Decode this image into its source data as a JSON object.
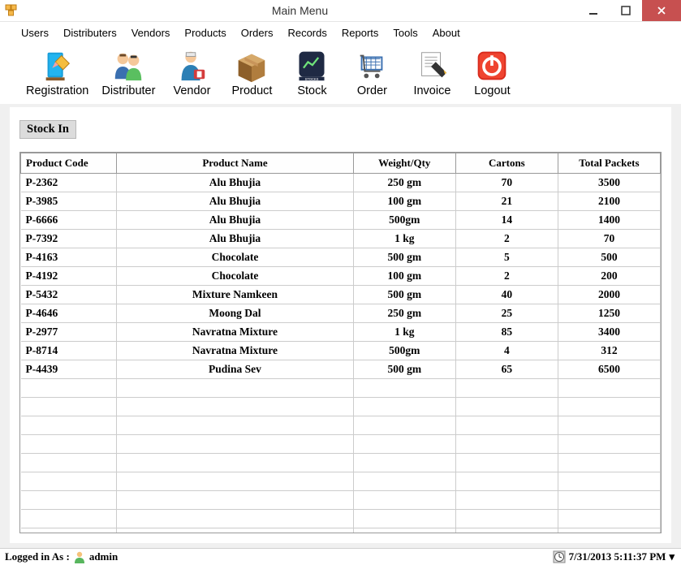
{
  "window": {
    "title": "Main Menu"
  },
  "menus": [
    "Users",
    "Distributers",
    "Vendors",
    "Products",
    "Orders",
    "Records",
    "Reports",
    "Tools",
    "About"
  ],
  "toolbar": [
    {
      "label": "Registration"
    },
    {
      "label": "Distributer"
    },
    {
      "label": "Vendor"
    },
    {
      "label": "Product"
    },
    {
      "label": "Stock"
    },
    {
      "label": "Order"
    },
    {
      "label": "Invoice"
    },
    {
      "label": "Logout"
    }
  ],
  "section": {
    "title": "Stock In"
  },
  "table": {
    "headers": [
      "Product Code",
      "Product Name",
      "Weight/Qty",
      "Cartons",
      "Total Packets"
    ],
    "rows": [
      [
        "P-2362",
        "Alu Bhujia",
        "250 gm",
        "70",
        "3500"
      ],
      [
        "P-3985",
        "Alu Bhujia",
        "100 gm",
        "21",
        "2100"
      ],
      [
        "P-6666",
        "Alu Bhujia",
        "500gm",
        "14",
        "1400"
      ],
      [
        "P-7392",
        "Alu Bhujia",
        "1 kg",
        "2",
        "70"
      ],
      [
        "P-4163",
        "Chocolate",
        "500 gm",
        "5",
        "500"
      ],
      [
        "P-4192",
        "Chocolate",
        "100 gm",
        "2",
        "200"
      ],
      [
        "P-5432",
        "Mixture Namkeen",
        "500 gm",
        "40",
        "2000"
      ],
      [
        "P-4646",
        "Moong Dal",
        "250 gm",
        "25",
        "1250"
      ],
      [
        "P-2977",
        "Navratna Mixture",
        "1 kg",
        "85",
        "3400"
      ],
      [
        "P-8714",
        "Navratna Mixture",
        "500gm",
        "4",
        "312"
      ],
      [
        "P-4439",
        "Pudina Sev",
        "500 gm",
        "65",
        "6500"
      ]
    ]
  },
  "status": {
    "login_label": "Logged in As :",
    "user": "admin",
    "datetime": "7/31/2013 5:11:37 PM",
    "datetime_arrow": "▾"
  }
}
